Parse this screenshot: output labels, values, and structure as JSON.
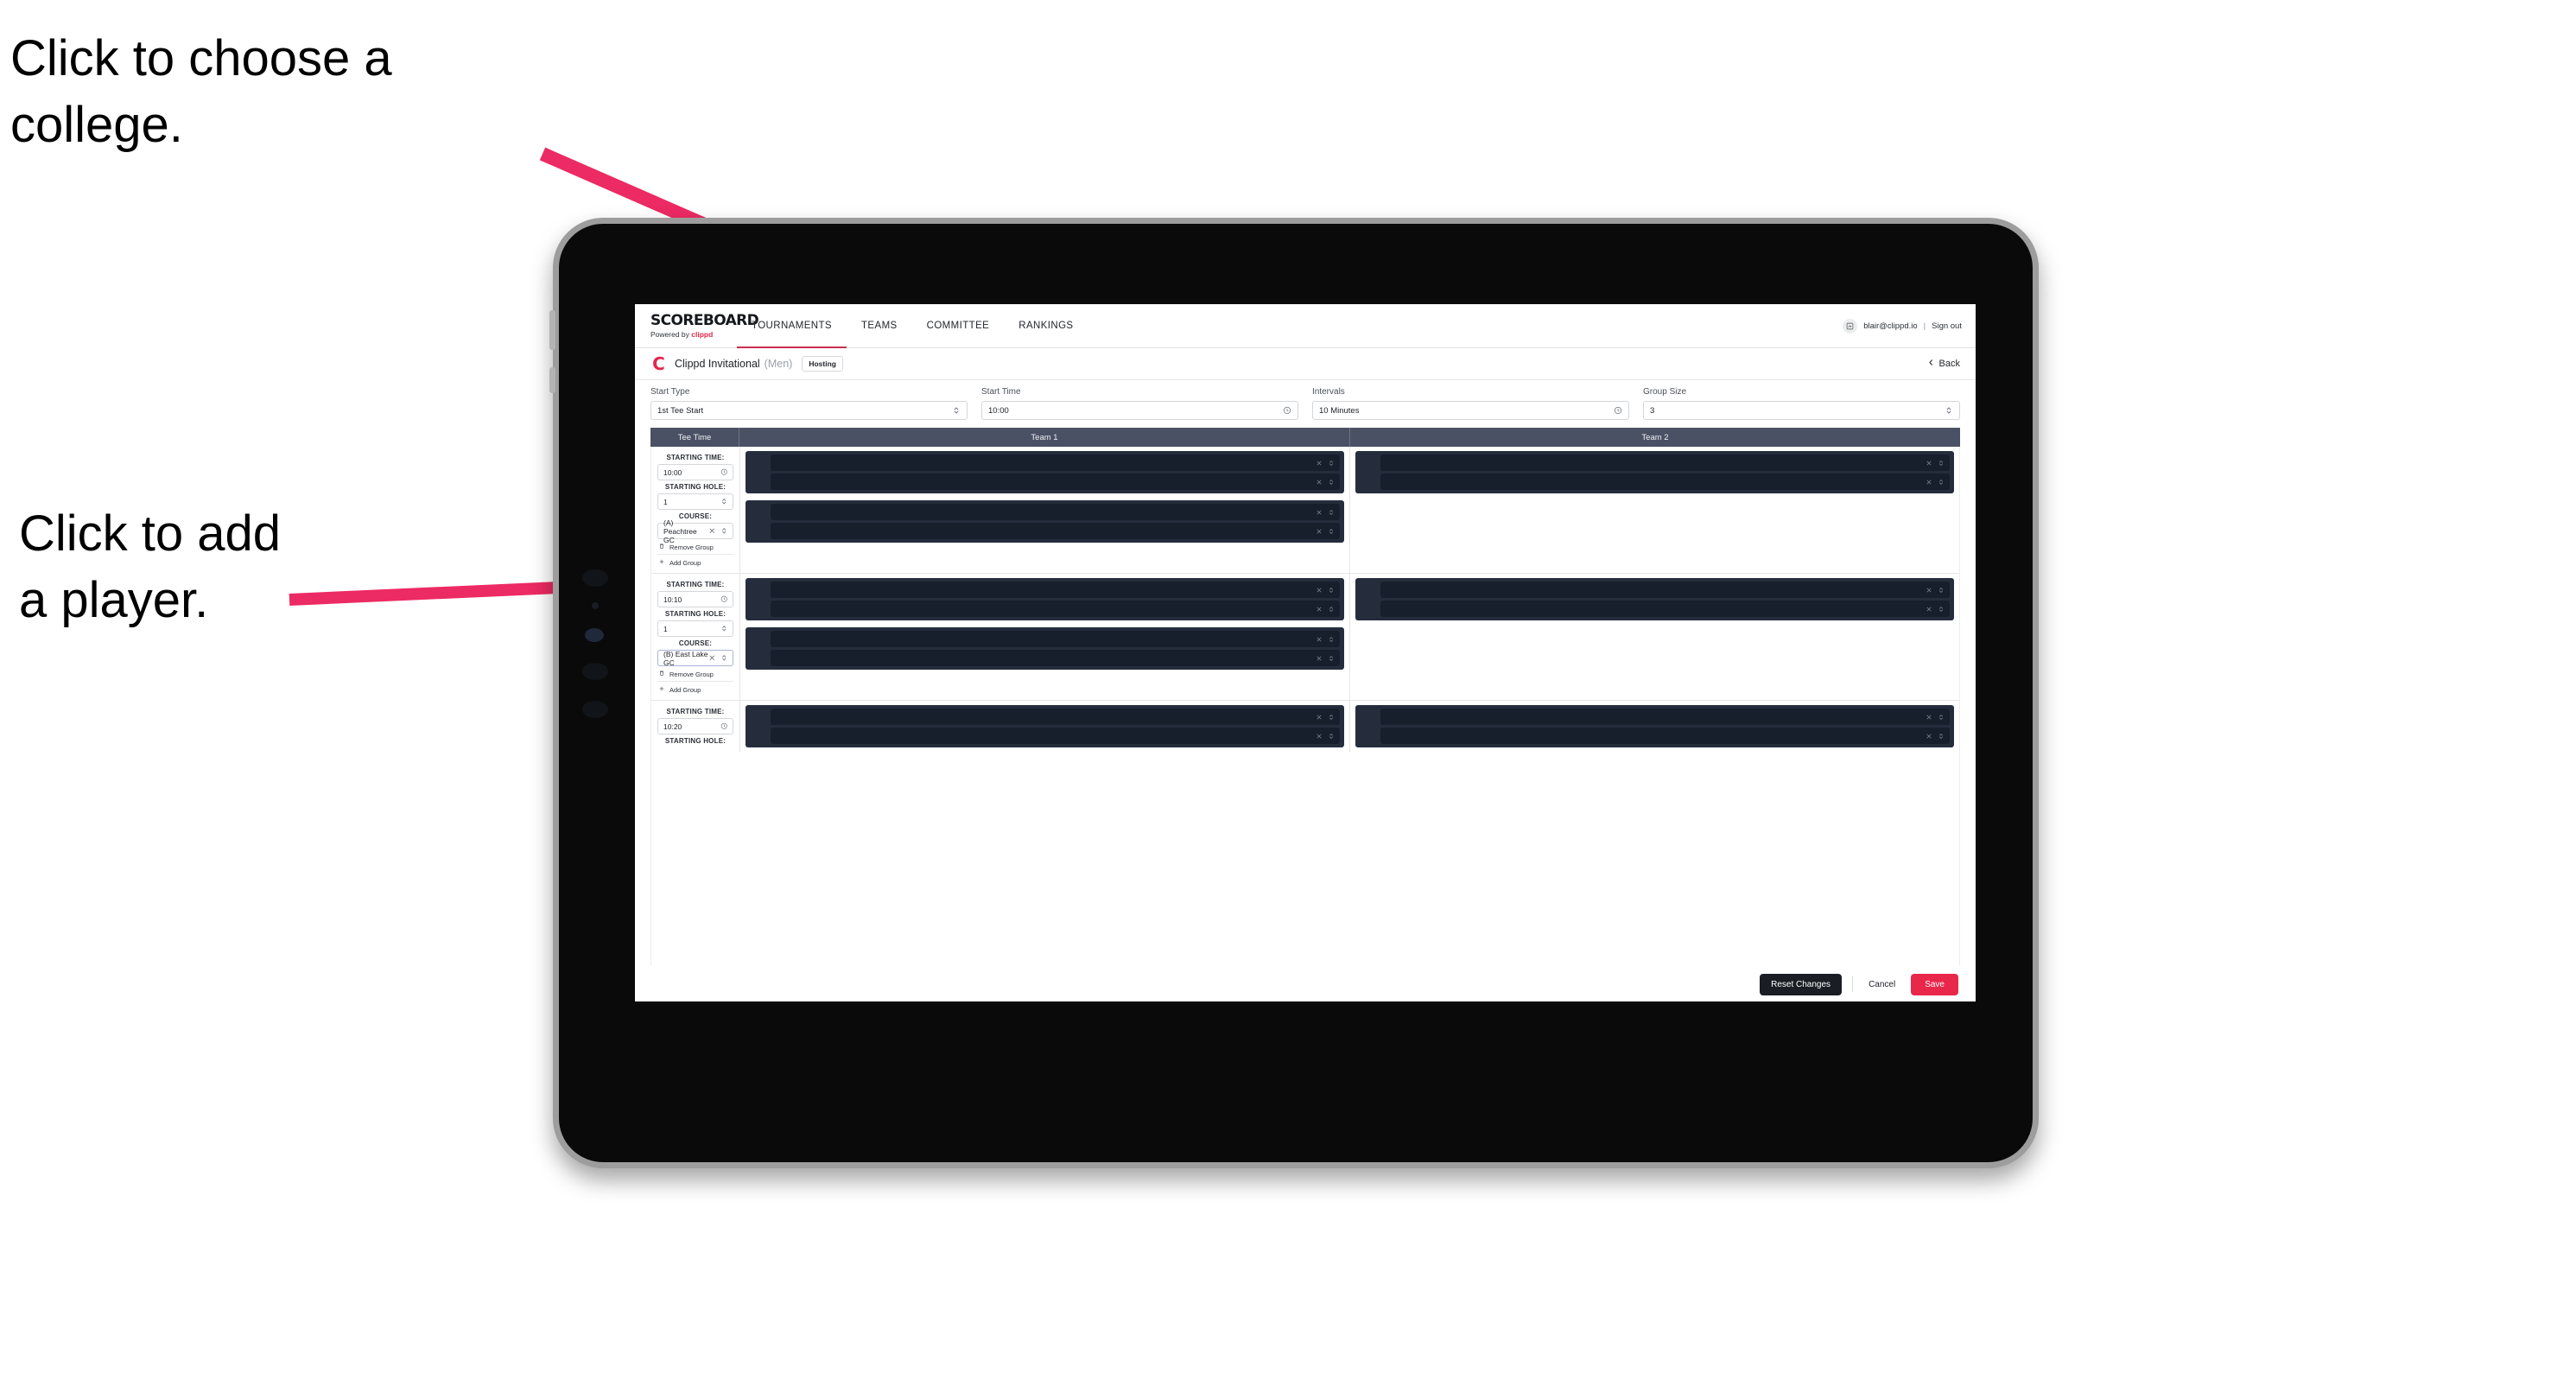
{
  "annotations": {
    "choose_college": "Click to choose a\ncollege.",
    "add_player": "Click to add\na player."
  },
  "colors": {
    "accent_pink": "#e8274b",
    "annotation_arrow": "#ec2a63",
    "table_header": "#4a5164",
    "slot_outer": "#252d3d",
    "slot_inner": "#171e2c"
  },
  "app": {
    "logo": {
      "main": "SCOREBOARD",
      "powered_prefix": "Powered by ",
      "powered_brand": "clippd"
    },
    "nav": [
      {
        "label": "TOURNAMENTS",
        "active": true
      },
      {
        "label": "TEAMS",
        "active": false
      },
      {
        "label": "COMMITTEE",
        "active": false
      },
      {
        "label": "RANKINGS",
        "active": false
      }
    ],
    "account": {
      "avatar_icon": "user-avatar-icon",
      "email": "blair@clippd.io",
      "separator": "|",
      "sign_out": "Sign out"
    },
    "breadcrumb": {
      "logo_letter": "C",
      "title": "Clippd Invitational",
      "gender": "(Men)",
      "badge": "Hosting",
      "back_label": "Back",
      "back_icon": "chevron-left-icon"
    },
    "settings": [
      {
        "label": "Start Type",
        "value": "1st Tee Start",
        "icon": "stepper-icon"
      },
      {
        "label": "Start Time",
        "value": "10:00",
        "icon": "clock-icon"
      },
      {
        "label": "Intervals",
        "value": "10 Minutes",
        "icon": "clock-icon"
      },
      {
        "label": "Group Size",
        "value": "3",
        "icon": "stepper-icon"
      }
    ],
    "table": {
      "columns": [
        "Tee Time",
        "Team 1",
        "Team 2"
      ],
      "labels": {
        "starting_time": "STARTING TIME:",
        "starting_hole": "STARTING HOLE:",
        "course": "COURSE:",
        "remove_group": "Remove Group",
        "add_group": "Add Group",
        "remove_icon": "trash-icon",
        "add_icon": "plus-icon",
        "clock_icon": "clock-icon",
        "stepper_icon": "stepper-icon",
        "clear_icon": "close-x-icon"
      },
      "rows": [
        {
          "starting_time": "10:00",
          "starting_hole": "1",
          "course": "(A) Peachtree GC",
          "course_focused": false,
          "team1_groups": [
            {
              "slots": 2
            },
            {
              "slots": 2
            }
          ],
          "team2_groups": [
            {
              "slots": 2
            }
          ]
        },
        {
          "starting_time": "10:10",
          "starting_hole": "1",
          "course": "(B) East Lake GC",
          "course_focused": true,
          "team1_groups": [
            {
              "slots": 2
            },
            {
              "slots": 2
            }
          ],
          "team2_groups": [
            {
              "slots": 2
            }
          ]
        },
        {
          "starting_time": "10:20",
          "starting_hole": "",
          "course": "",
          "course_focused": false,
          "team1_groups": [
            {
              "slots": 2
            }
          ],
          "team2_groups": [
            {
              "slots": 2
            }
          ]
        }
      ]
    },
    "footer": {
      "reset": "Reset Changes",
      "cancel": "Cancel",
      "save": "Save"
    }
  }
}
